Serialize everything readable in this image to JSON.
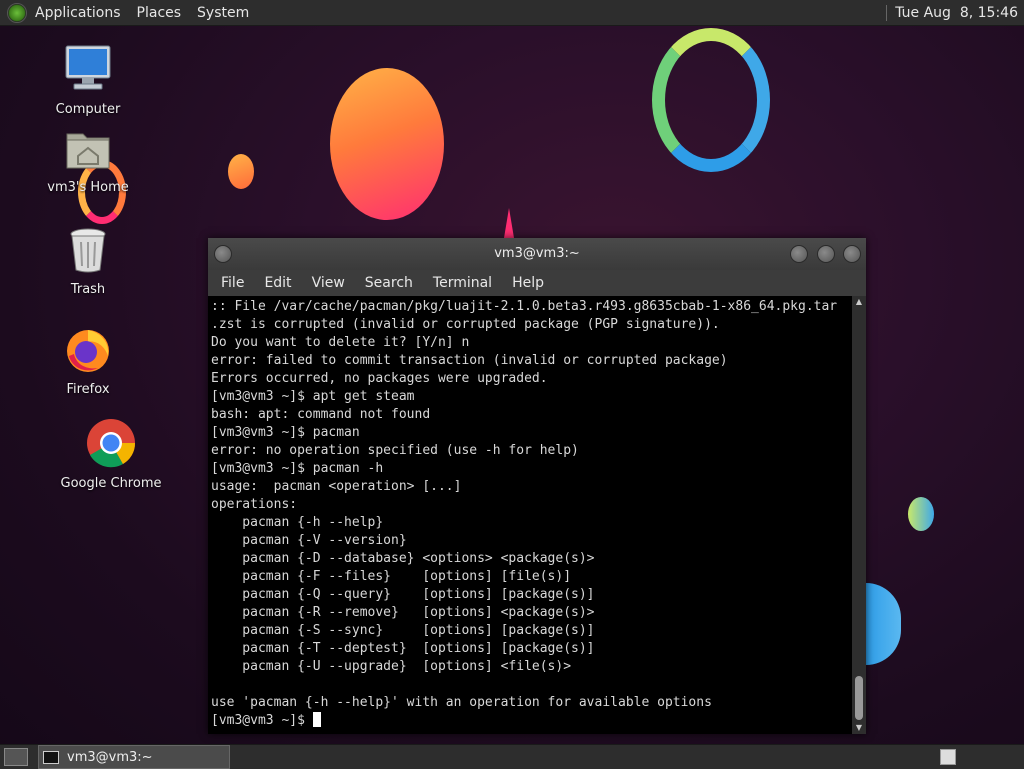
{
  "top_panel": {
    "menus": [
      "Applications",
      "Places",
      "System"
    ],
    "clock": "Tue Aug  8, 15:46"
  },
  "desktop_icons": [
    {
      "label": "Computer",
      "icon": "computer-icon"
    },
    {
      "label": "vm3's Home",
      "icon": "home-folder-icon"
    },
    {
      "label": "Trash",
      "icon": "trash-icon"
    },
    {
      "label": "Firefox",
      "icon": "firefox-icon"
    },
    {
      "label": "Google Chrome",
      "icon": "chrome-icon"
    }
  ],
  "terminal": {
    "title": "vm3@vm3:~",
    "menu": [
      "File",
      "Edit",
      "View",
      "Search",
      "Terminal",
      "Help"
    ],
    "lines": [
      ":: File /var/cache/pacman/pkg/luajit-2.1.0.beta3.r493.g8635cbab-1-x86_64.pkg.tar",
      ".zst is corrupted (invalid or corrupted package (PGP signature)).",
      "Do you want to delete it? [Y/n] n",
      "error: failed to commit transaction (invalid or corrupted package)",
      "Errors occurred, no packages were upgraded.",
      "[vm3@vm3 ~]$ apt get steam",
      "bash: apt: command not found",
      "[vm3@vm3 ~]$ pacman",
      "error: no operation specified (use -h for help)",
      "[vm3@vm3 ~]$ pacman -h",
      "usage:  pacman <operation> [...]",
      "operations:",
      "    pacman {-h --help}",
      "    pacman {-V --version}",
      "    pacman {-D --database} <options> <package(s)>",
      "    pacman {-F --files}    [options] [file(s)]",
      "    pacman {-Q --query}    [options] [package(s)]",
      "    pacman {-R --remove}   [options] <package(s)>",
      "    pacman {-S --sync}     [options] [package(s)]",
      "    pacman {-T --deptest}  [options] [package(s)]",
      "    pacman {-U --upgrade}  [options] <file(s)>",
      "",
      "use 'pacman {-h --help}' with an operation for available options"
    ],
    "prompt": "[vm3@vm3 ~]$ "
  },
  "taskbar": {
    "task_label": "vm3@vm3:~"
  }
}
